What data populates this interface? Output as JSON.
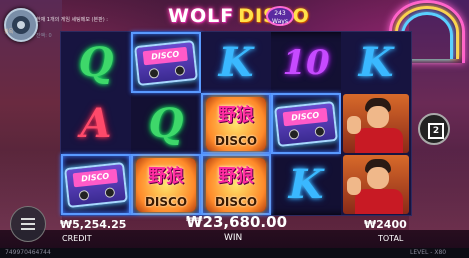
{
  "game": {
    "title_a": "WOLF",
    "title_b": "DISCO",
    "ways": "243 Ways"
  },
  "notice": {
    "line1": "한재 1개의 게임 세팅메모 (본판) :",
    "line2": "항목",
    "line3": "잔액: 0"
  },
  "symbols": {
    "cassette_label": "DISCO",
    "wild_kanji": "野狼",
    "wild_word": "DISCO"
  },
  "reels": [
    [
      "Q",
      "A",
      "cassette"
    ],
    [
      "cassette",
      "Q",
      "wild"
    ],
    [
      "K",
      "wild",
      "wild"
    ],
    [
      "10",
      "cassette",
      "K"
    ],
    [
      "K",
      "man",
      "man"
    ]
  ],
  "counter": "2",
  "credit": {
    "value": "₩5,254.25",
    "label": "CREDIT"
  },
  "win": {
    "value": "₩23,680.00",
    "label": "WIN"
  },
  "total": {
    "value": "₩2400",
    "label": "TOTAL"
  },
  "footer": {
    "id": "749970464744",
    "level": "LEVEL - X80"
  },
  "colors": {
    "q": "#3ed86a",
    "k": "#3ab8ff",
    "a": "#ff4a6a",
    "ten": "#c64aff",
    "accent": "#ff3fb0"
  }
}
